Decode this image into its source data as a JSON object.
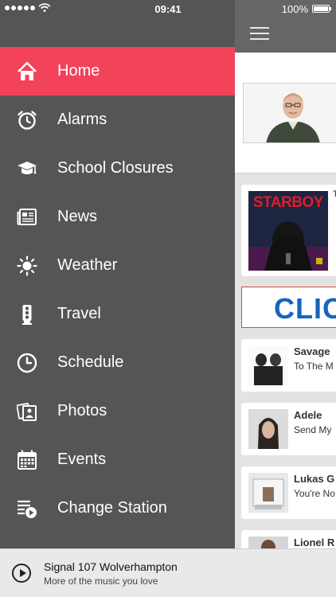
{
  "status_bar": {
    "time": "09:41",
    "battery": "100%"
  },
  "menu": {
    "items": [
      {
        "label": "Home",
        "icon": "home-icon",
        "active": true
      },
      {
        "label": "Alarms",
        "icon": "alarm-clock-icon",
        "active": false
      },
      {
        "label": "School Closures",
        "icon": "graduation-cap-icon",
        "active": false
      },
      {
        "label": "News",
        "icon": "newspaper-icon",
        "active": false
      },
      {
        "label": "Weather",
        "icon": "sun-icon",
        "active": false
      },
      {
        "label": "Travel",
        "icon": "traffic-light-icon",
        "active": false
      },
      {
        "label": "Schedule",
        "icon": "clock-icon",
        "active": false
      },
      {
        "label": "Photos",
        "icon": "photos-icon",
        "active": false
      },
      {
        "label": "Events",
        "icon": "calendar-icon",
        "active": false
      },
      {
        "label": "Change Station",
        "icon": "playlist-icon",
        "active": false
      }
    ],
    "active_color": "#f2435a",
    "background_color": "#555555"
  },
  "content": {
    "big_card_album_text": "STARBOY",
    "banner_text": "CLIC",
    "tracks": [
      {
        "artist": "Savage",
        "title": "To The M"
      },
      {
        "artist": "Adele",
        "title": "Send My"
      },
      {
        "artist": "Lukas G",
        "title": "You're No"
      },
      {
        "artist": "Lionel R",
        "title": ""
      }
    ]
  },
  "player": {
    "station_name": "Signal 107 Wolverhampton",
    "tagline": "More of the music you love"
  }
}
